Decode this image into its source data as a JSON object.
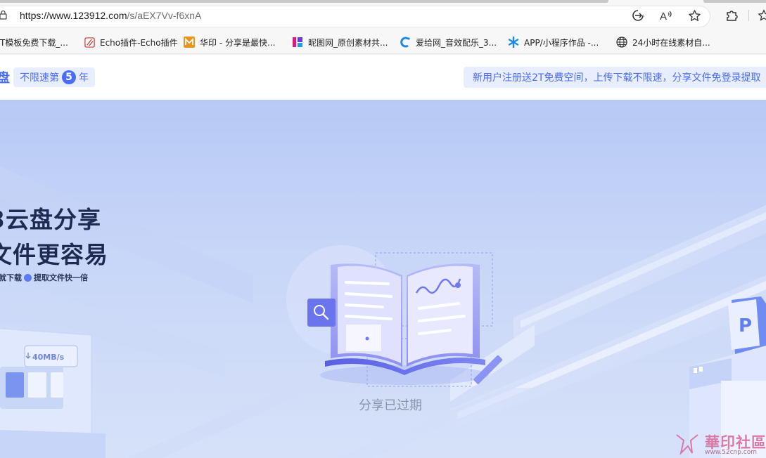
{
  "browser": {
    "url_host": "https://www.123912.com",
    "url_path": "/s/aEX7Vv-f6xnA",
    "icons": [
      "lock-icon",
      "refresh-icon",
      "read-aloud-icon",
      "favorite-star-icon",
      "extensions-icon",
      "favorites-icon"
    ]
  },
  "bookmarks": [
    {
      "label": "T模板免费下载_...",
      "icon": "template-site-icon"
    },
    {
      "label": "Echo插件-Echo插件",
      "icon": "echo-icon"
    },
    {
      "label": "华印 - 分享是最快...",
      "icon": "huayin-icon"
    },
    {
      "label": "昵图网_原创素材共...",
      "icon": "nipic-icon"
    },
    {
      "label": "爱给网_音效配乐_3...",
      "icon": "aigei-icon"
    },
    {
      "label": "APP/小程序作品 -...",
      "icon": "app-works-icon"
    },
    {
      "label": "24小时在线素材自...",
      "icon": "globe-icon"
    }
  ],
  "header": {
    "logo_fragment": "盘",
    "badge_prefix": "不限速第",
    "badge_number": "5",
    "badge_suffix": "年",
    "promo_text": "新用户注册送2T免费空间，上传下载不限速，分享文件免登录提取"
  },
  "hero": {
    "slogan_line1": "3云盘分享",
    "slogan_line2": "文件更容易",
    "sub_part1": "就下载",
    "sub_part2": "提取文件快一倍",
    "speed_label": "40MB/s",
    "status_text": "分享已过期"
  },
  "watermark": {
    "title": "華印社區",
    "url": "www.52cnp.com"
  },
  "colors": {
    "accent": "#4a6cf7",
    "hero_bg": "#c7d5f7",
    "status_text": "#8a94aa"
  }
}
